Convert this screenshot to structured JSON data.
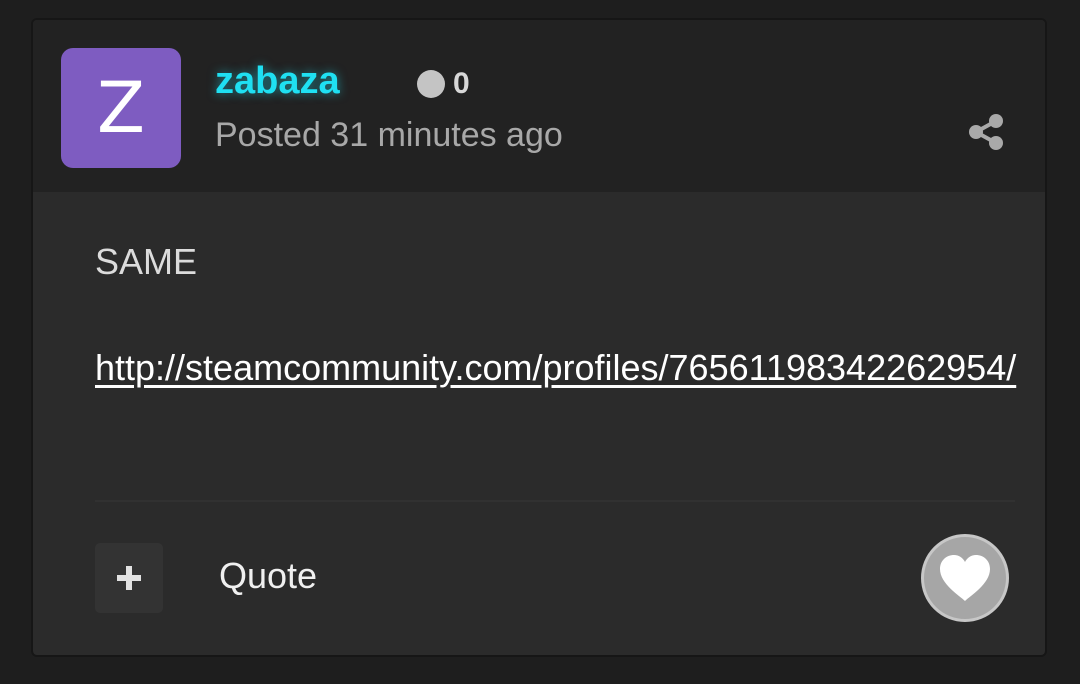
{
  "post": {
    "author": {
      "avatar_letter": "Z",
      "avatar_color": "#7e5cc1",
      "username": "zabaza",
      "username_color": "#1fe0f2",
      "reputation": "0"
    },
    "posted": "Posted 31 minutes ago",
    "body": {
      "text": "SAME",
      "link": "http://steamcommunity.com/profiles/76561198342262954/"
    },
    "actions": {
      "multiquote_icon": "plus-icon",
      "quote_label": "Quote",
      "like_icon": "heart-icon",
      "share_icon": "share-icon"
    }
  }
}
